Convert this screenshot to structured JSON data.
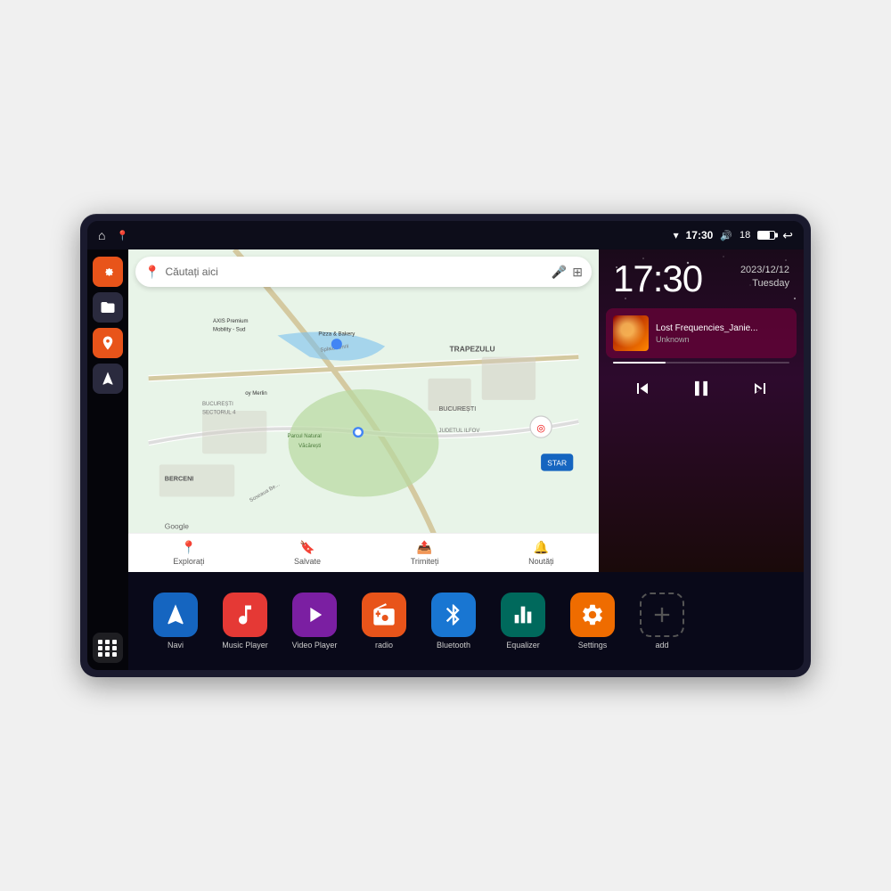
{
  "device": {
    "status_bar": {
      "wifi_icon": "▾",
      "time": "17:30",
      "volume_icon": "🔊",
      "battery_level": "18",
      "back_icon": "↩"
    },
    "home_icon": "⌂",
    "location_icon": "📍"
  },
  "sidebar": {
    "buttons": [
      {
        "id": "settings",
        "label": "Settings"
      },
      {
        "id": "folder",
        "label": "Folder"
      },
      {
        "id": "maps",
        "label": "Maps"
      },
      {
        "id": "navi",
        "label": "Navi"
      }
    ],
    "apps_grid": "Apps Grid"
  },
  "map": {
    "search_placeholder": "Căutați aici",
    "locations": [
      "AXIS Premium Mobility - Sud",
      "Pizza & Bakery",
      "Parcul Natural Văcărești",
      "TRAPEZULU",
      "BUCUREȘTI",
      "BUCUREȘTI SECTORUL 4",
      "JUDETUL ILFOV",
      "BERCENI"
    ],
    "nav_items": [
      {
        "label": "Explorați",
        "icon": "📍"
      },
      {
        "label": "Salvate",
        "icon": "🔖"
      },
      {
        "label": "Trimiteți",
        "icon": "📤"
      },
      {
        "label": "Noutăți",
        "icon": "🔔"
      }
    ],
    "google_label": "Google"
  },
  "music": {
    "clock": "17:30",
    "date_year": "2023/12/12",
    "date_day": "Tuesday",
    "track_name": "Lost Frequencies_Janie...",
    "track_artist": "Unknown",
    "controls": {
      "prev": "⏮",
      "play_pause": "⏸",
      "next": "⏭"
    }
  },
  "apps": [
    {
      "id": "navi",
      "label": "Navi",
      "color": "blue",
      "icon": "▲"
    },
    {
      "id": "music",
      "label": "Music Player",
      "color": "red",
      "icon": "♪"
    },
    {
      "id": "video",
      "label": "Video Player",
      "color": "purple",
      "icon": "▶"
    },
    {
      "id": "radio",
      "label": "radio",
      "color": "orange",
      "icon": "📻"
    },
    {
      "id": "bluetooth",
      "label": "Bluetooth",
      "color": "blue-light",
      "icon": "⬡"
    },
    {
      "id": "equalizer",
      "label": "Equalizer",
      "color": "teal",
      "icon": "≡"
    },
    {
      "id": "settings",
      "label": "Settings",
      "color": "orange2",
      "icon": "⚙"
    },
    {
      "id": "add",
      "label": "add",
      "color": "gray",
      "icon": "+"
    }
  ]
}
